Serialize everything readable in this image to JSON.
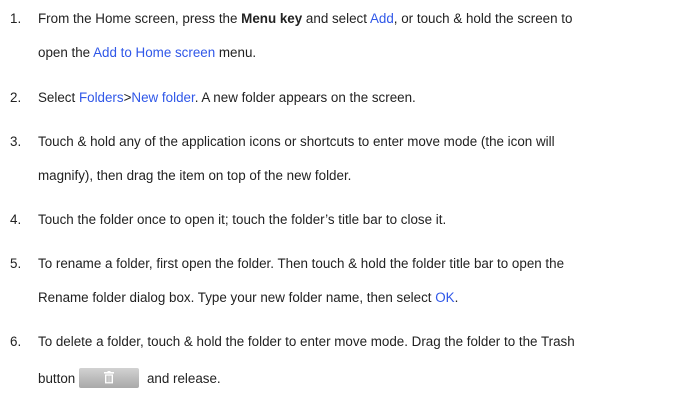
{
  "steps": [
    {
      "number": "1.",
      "parts": {
        "a": "From the Home screen, press the ",
        "b": "Menu key",
        "c": " and select ",
        "d": "Add",
        "e": ", or touch & hold the screen to",
        "f": "open the ",
        "g": "Add to Home screen",
        "h": " menu."
      }
    },
    {
      "number": "2.",
      "parts": {
        "a": "Select ",
        "b": "Folders",
        "c": ">",
        "d": "New folder",
        "e": ". A new folder appears on the screen."
      }
    },
    {
      "number": "3.",
      "parts": {
        "a": "Touch & hold any of the application icons or shortcuts to enter move mode (the icon will",
        "b": "magnify), then drag the item on top of the new folder."
      }
    },
    {
      "number": "4.",
      "parts": {
        "a": "Touch the folder once to open it; touch the folder’s title bar to close it."
      }
    },
    {
      "number": "5.",
      "parts": {
        "a": "To rename a folder, first open the folder. Then touch & hold the folder title bar to open the",
        "b": "Rename folder dialog box. Type your new folder name, then select ",
        "c": "OK",
        "d": "."
      }
    },
    {
      "number": "6.",
      "parts": {
        "a": "To delete a folder, touch & hold the folder to enter move mode. Drag the folder to the Trash",
        "b": "button",
        "c": " and release."
      }
    }
  ],
  "colors": {
    "link": "#2f57e8",
    "text": "#222222",
    "trash_button": "#bdbdbd"
  },
  "icons": {
    "trash_button_icon": "trash-icon"
  }
}
